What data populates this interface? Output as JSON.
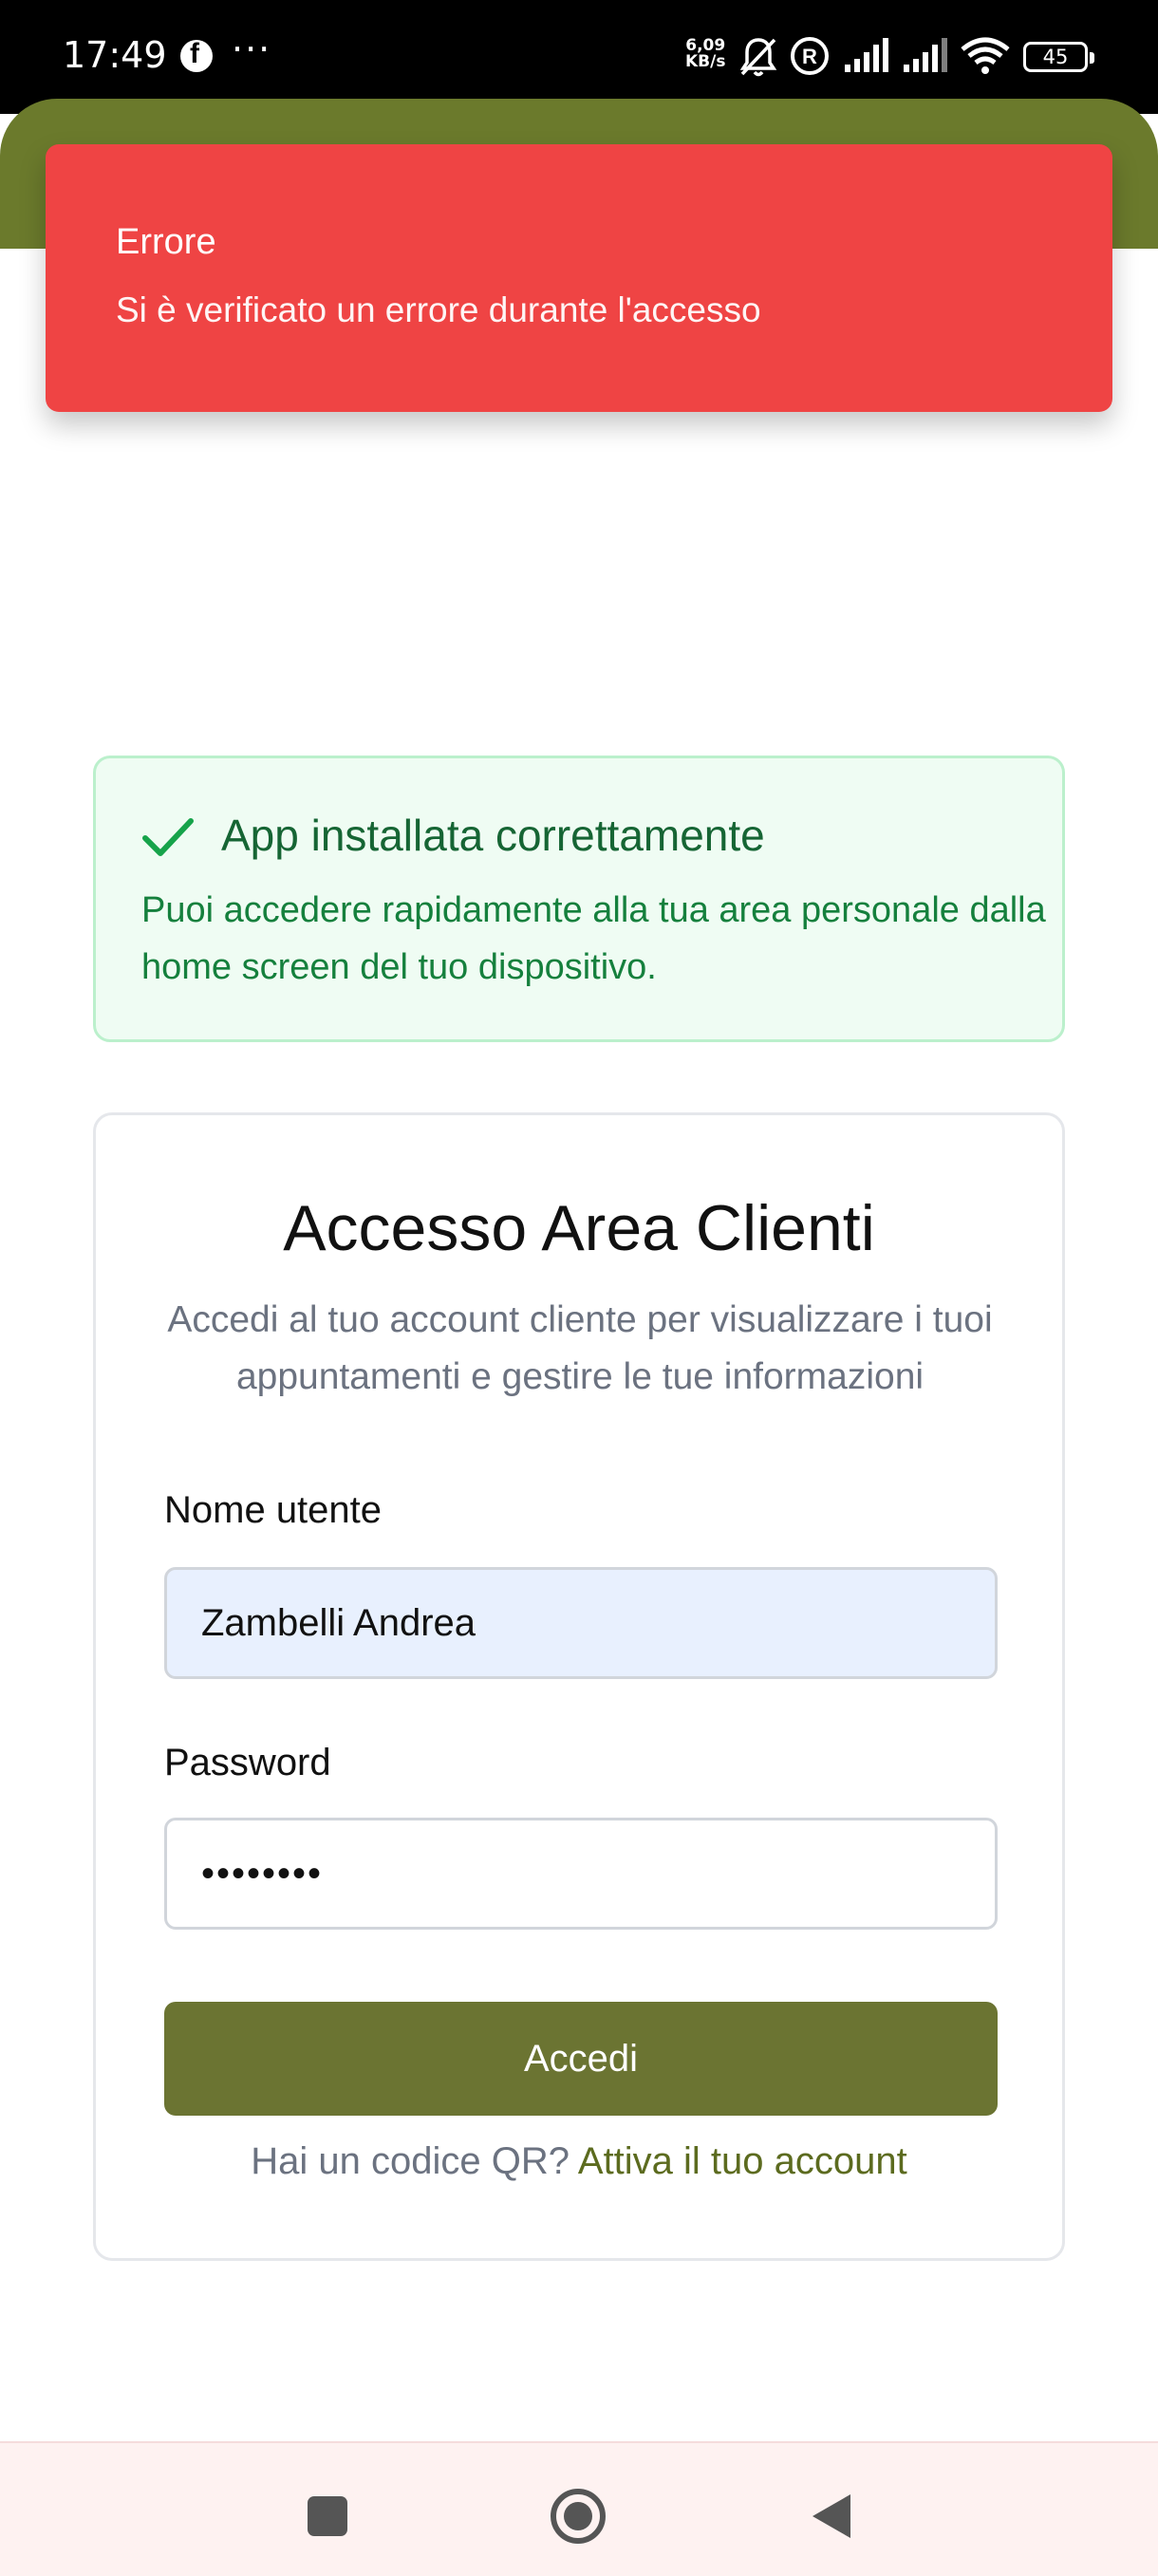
{
  "status_bar": {
    "time": "17:49",
    "more": "···",
    "speed_value": "6,09",
    "speed_unit": "KB/s",
    "battery": "45",
    "icons": [
      "facebook-icon",
      "mute-bell-icon",
      "registered-icon",
      "signal-icon",
      "signal-icon",
      "wifi-icon",
      "battery-icon"
    ]
  },
  "toast": {
    "title": "Errore",
    "message": "Si è verificato un errore durante l'accesso",
    "color": "#ef4444"
  },
  "install_notice": {
    "title": "App installata correttamente",
    "text": "Puoi accedere rapidamente alla tua area personale dalla home screen del tuo dispositivo.",
    "icon": "check-icon"
  },
  "login": {
    "title": "Accesso Area Clienti",
    "description": "Accedi al tuo account cliente per visualizzare i tuoi appuntamenti e gestire le tue informazioni",
    "username_label": "Nome utente",
    "username_value": "Zambelli Andrea",
    "password_label": "Password",
    "password_value": "••••••••",
    "submit_label": "Accedi",
    "qr_prompt": "Hai un codice QR?",
    "activate_link": "Attiva il tuo account"
  },
  "colors": {
    "brand": "#6b7432",
    "success": "#15803d",
    "error": "#ef4444"
  },
  "nav_bar": {
    "icons": [
      "recents-icon",
      "home-icon",
      "back-icon"
    ]
  }
}
